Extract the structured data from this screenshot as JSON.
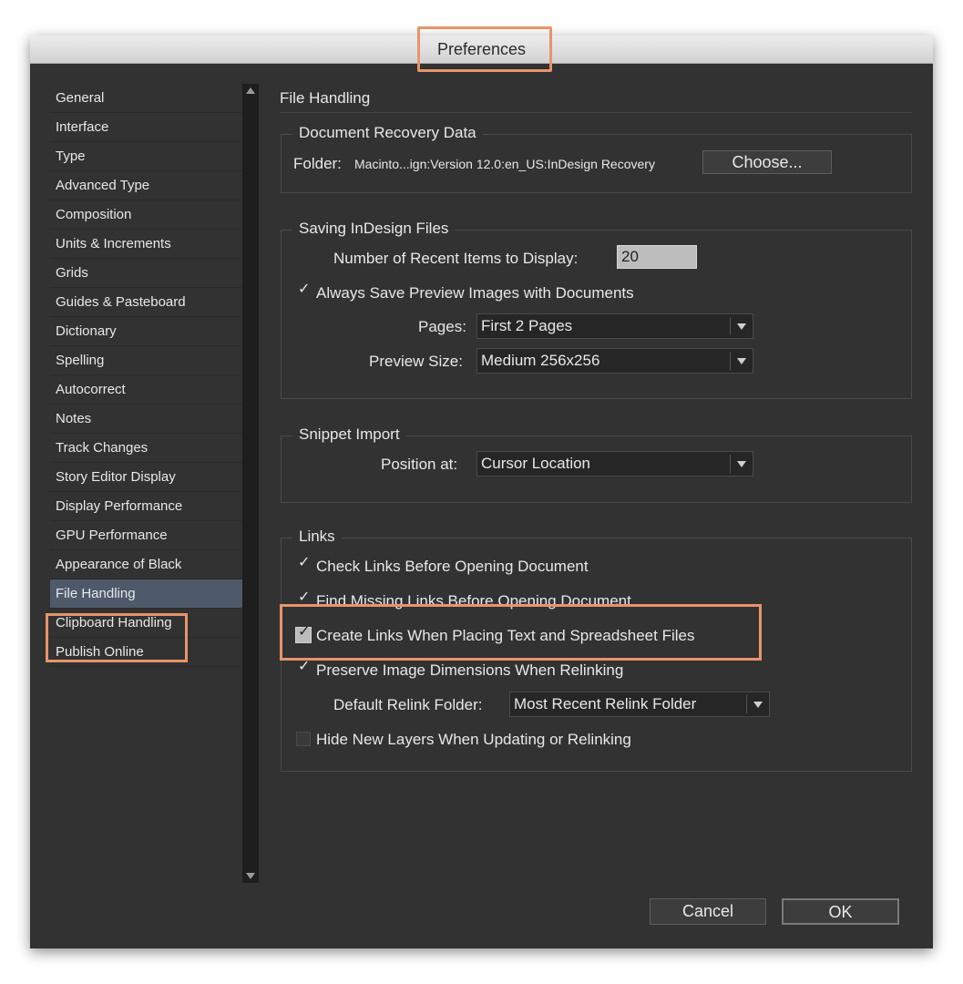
{
  "window": {
    "title": "Preferences"
  },
  "sidebar": {
    "items": [
      {
        "label": "General"
      },
      {
        "label": "Interface"
      },
      {
        "label": "Type"
      },
      {
        "label": "Advanced Type"
      },
      {
        "label": "Composition"
      },
      {
        "label": "Units & Increments"
      },
      {
        "label": "Grids"
      },
      {
        "label": "Guides & Pasteboard"
      },
      {
        "label": "Dictionary"
      },
      {
        "label": "Spelling"
      },
      {
        "label": "Autocorrect"
      },
      {
        "label": "Notes"
      },
      {
        "label": "Track Changes"
      },
      {
        "label": "Story Editor Display"
      },
      {
        "label": "Display Performance"
      },
      {
        "label": "GPU Performance"
      },
      {
        "label": "Appearance of Black"
      },
      {
        "label": "File Handling"
      },
      {
        "label": "Clipboard Handling"
      },
      {
        "label": "Publish Online"
      }
    ],
    "selected": "File Handling"
  },
  "panel": {
    "title": "File Handling",
    "recovery": {
      "title": "Document Recovery Data",
      "folder_label": "Folder:",
      "folder_path": "Macinto...ign:Version 12.0:en_US:InDesign Recovery",
      "choose_label": "Choose..."
    },
    "saving": {
      "title": "Saving InDesign Files",
      "recent_label": "Number of Recent Items to Display:",
      "recent_value": "20",
      "always_save_label": "Always Save Preview Images with Documents",
      "always_save_checked": true,
      "pages_label": "Pages:",
      "pages_value": "First 2 Pages",
      "preview_size_label": "Preview Size:",
      "preview_size_value": "Medium 256x256"
    },
    "snippet": {
      "title": "Snippet Import",
      "position_label": "Position at:",
      "position_value": "Cursor Location"
    },
    "links": {
      "title": "Links",
      "check_links_label": "Check Links Before Opening Document",
      "find_missing_label": "Find Missing Links Before Opening Document",
      "create_links_label": "Create Links When Placing Text and Spreadsheet Files",
      "preserve_label": "Preserve Image Dimensions When Relinking",
      "relink_folder_label": "Default Relink Folder:",
      "relink_folder_value": "Most Recent Relink Folder",
      "hide_layers_label": "Hide New Layers When Updating or Relinking"
    }
  },
  "footer": {
    "cancel_label": "Cancel",
    "ok_label": "OK"
  }
}
